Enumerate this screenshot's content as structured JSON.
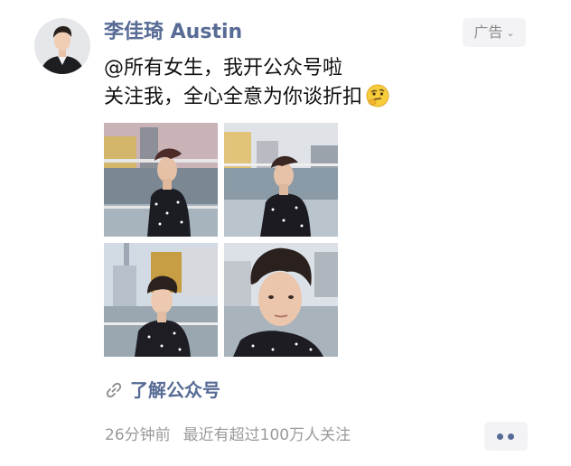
{
  "post": {
    "author": "李佳琦 Austin",
    "ad_label": "广告",
    "text_line1": "@所有女生，我开公众号啦",
    "text_line2": "关注我，全心全意为你谈折扣",
    "emoji": "thinking-face-emoji",
    "photos": [
      {
        "name": "photo-1"
      },
      {
        "name": "photo-2"
      },
      {
        "name": "photo-3"
      },
      {
        "name": "photo-4"
      }
    ],
    "link_label": "了解公众号",
    "time": "26分钟前",
    "reach": "最近有超过100万人关注"
  },
  "icons": {
    "ad_chevron": "chevron-down-icon",
    "link": "link-icon",
    "more": "more-dots-icon"
  },
  "colors": {
    "link_blue": "#576b95",
    "meta_gray": "#9a9a9a",
    "button_bg": "#f3f3f5"
  }
}
